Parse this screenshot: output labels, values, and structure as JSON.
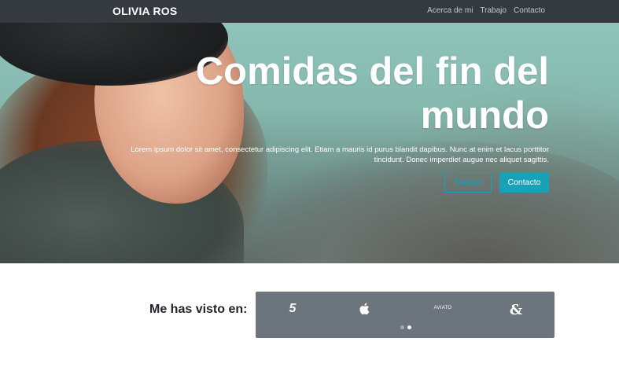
{
  "navbar": {
    "brand": "OLIVIA ROS",
    "links": [
      "Acerca de mi",
      "Trabajo",
      "Contacto"
    ]
  },
  "hero": {
    "title": "Comidas del fin del mundo",
    "text": "Lorem ipsum dolor sit amet, consectetur adipiscing elit. Etiam a mauris id purus blandit dapibus. Nunc at enim et lacus porttitor tincidunt. Donec imperdiet augue nec aliquet sagittis.",
    "btn_work": "Trabajo",
    "btn_contact": "Contacto"
  },
  "seen": {
    "label": "Me has visto en:",
    "logos": [
      "five-icon",
      "apple-icon",
      "aviato-icon",
      "ampersand-icon"
    ],
    "five_text": "5",
    "aviato_text": "AVIATO",
    "amp_text": "&",
    "active_slide": 2,
    "slide_count": 2
  },
  "colors": {
    "navbar_bg": "#343a40",
    "accent": "#17a2b8",
    "carousel_bg": "#6c757d"
  }
}
